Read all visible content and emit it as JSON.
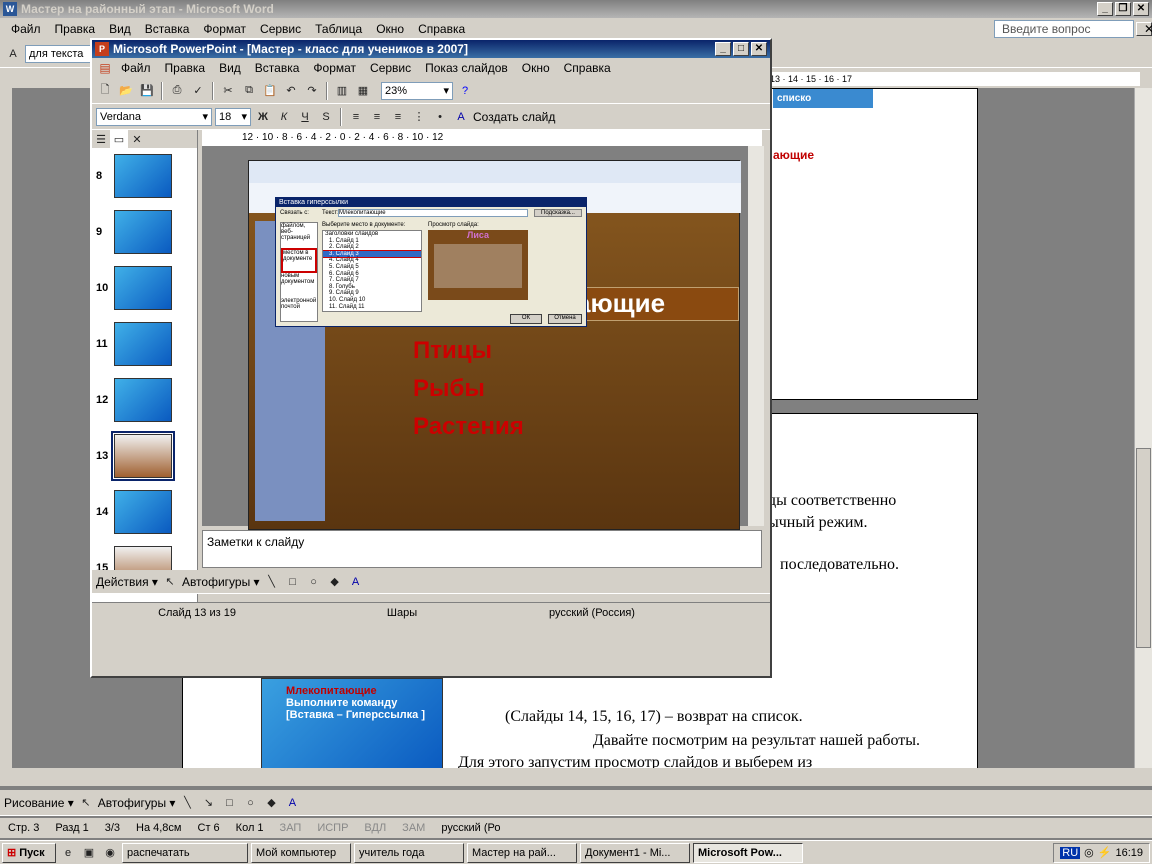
{
  "word": {
    "title": "Мастер на районный этап - Microsoft Word",
    "menu": [
      "Файл",
      "Правка",
      "Вид",
      "Вставка",
      "Формат",
      "Сервис",
      "Таблица",
      "Окно",
      "Справка"
    ],
    "help_placeholder": "Введите вопрос",
    "style_box": "для текста",
    "body_lines": [
      "ды соответственно",
      "ычный режим.",
      "последовательно."
    ],
    "para1": "(Слайды 14, 15, 16, 17) – возврат на список.",
    "para2a": "Давайте посмотрим на результат нашей работы.",
    "para2b": "Для этого запустим просмотр слайдов и выберем из",
    "thumb_lines": [
      "Млекопитающие",
      "Выполните команду",
      "[Вставка – Гиперссылка ]"
    ],
    "top_thumb": [
      "списко",
      "ающие"
    ],
    "draw_label": "Рисование ▾",
    "autoshapes": "Автофигуры ▾",
    "status": [
      "Стр. 3",
      "Разд 1",
      "3/3",
      "На 4,8см",
      "Ст 6",
      "Кол 1",
      "ЗАП",
      "ИСПР",
      "ВДЛ",
      "ЗАМ",
      "русский (Ро"
    ],
    "ruler_nums": "13 · 14 · 15 · 16 · 17"
  },
  "ppt": {
    "title": "Microsoft PowerPoint - [Мастер - класс для учеников в 2007]",
    "menu": [
      "Файл",
      "Правка",
      "Вид",
      "Вставка",
      "Формат",
      "Сервис",
      "Показ слайдов",
      "Окно",
      "Справка"
    ],
    "zoom": "23%",
    "font": "Verdana",
    "size": "18",
    "new_slide": "Создать слайд",
    "ruler": "12 · 10 · 8 · 6 · 4 · 2 · 0 · 2 · 4 · 6 · 8 · 10 · 12",
    "slide_nums": [
      "8",
      "9",
      "10",
      "11",
      "12",
      "13",
      "14",
      "15"
    ],
    "notes": "Заметки к слайду",
    "actions": "Действия ▾",
    "autoshapes": "Автофигуры ▾",
    "status": [
      "Слайд 13 из 19",
      "Шары",
      "русский (Россия)"
    ],
    "slide_items": [
      "Птицы",
      "Рыбы",
      "Растения"
    ],
    "header_frag": "ающие",
    "dialog_title": "Вставка гиперссылки",
    "dialog_text_label": "Текст:",
    "dialog_text": "Млекопитающие",
    "dialog_link": "Связать с:",
    "dialog_place": "Выберите место в документе:",
    "dialog_preview": "Просмотр слайда:",
    "dialog_preview_title": "Лиса",
    "dialog_list": [
      "Заголовки слайдов",
      "1. Слайд 1",
      "2. Слайд 2",
      "3. Слайд 3",
      "4. Слайд 4",
      "5. Слайд 5",
      "6. Слайд 6",
      "7. Слайд 7",
      "8. Голубь",
      "9. Слайд 9",
      "10. Слайд 10",
      "11. Слайд 11"
    ],
    "dialog_left": [
      "файлом, веб-страницей",
      "местом в документе",
      "новым документом",
      "электронной почтой"
    ],
    "ok": "ОК",
    "cancel": "Отмена",
    "hint": "Подсказка..."
  },
  "taskbar": {
    "start": "Пуск",
    "items": [
      "распечатать",
      "Мой компьютер",
      "учитель года",
      "Мастер на рай...",
      "Документ1 - Mi...",
      "Microsoft Pow..."
    ],
    "clock": "16:19",
    "lang": "RU"
  }
}
